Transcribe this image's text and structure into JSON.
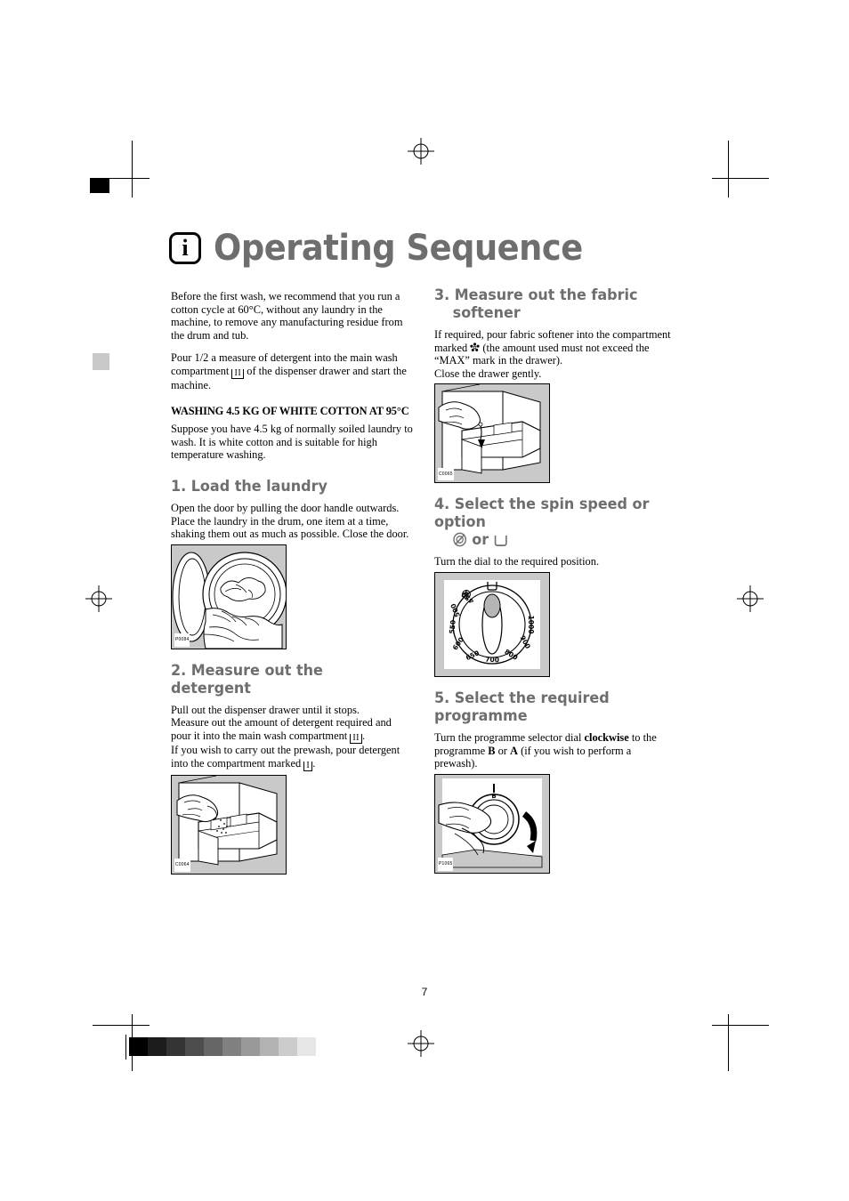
{
  "document": {
    "page_number": "7",
    "title": "Operating Sequence",
    "title_icon": "info-icon",
    "info_glyph": "i"
  },
  "left_column": {
    "intro": {
      "paragraph_1": "Before the first wash, we recommend that you run a cotton cycle at 60°C, without any laundry in the machine, to remove any manufacturing residue from the drum and tub.",
      "paragraph_2_part_1": "Pour 1/2 a measure of detergent into the main wash compartment ",
      "compartment_main": "II",
      "paragraph_2_part_2": " of the dispenser drawer and start the machine."
    },
    "subheading": "WASHING 4.5 KG OF WHITE COTTON AT 95°C",
    "subheading_body": "Suppose you have 4.5 kg of normally soiled laundry to wash. It is white cotton and is suitable for high temperature washing.",
    "step1": {
      "heading": "1. Load the laundry",
      "body": "Open the door by pulling the door handle outwards. Place the laundry in the drum, one item at a time, shaking them out as much as possible. Close the door.",
      "figure_code": "P0084",
      "figure_name": "loading-laundry-illustration"
    },
    "step2": {
      "heading": "2. Measure out the detergent",
      "body_1": "Pull out the dispenser drawer until it stops.",
      "body_2_part_1": "Measure out the amount of detergent required and pour it into the main wash compartment ",
      "compartment_main": "II",
      "body_2_part_2": ".",
      "body_3_part_1": "If you wish to carry out the prewash, pour detergent into the compartment marked ",
      "compartment_prewash": "I",
      "body_3_part_2": ".",
      "figure_code": "C0064",
      "figure_name": "detergent-drawer-illustration"
    }
  },
  "right_column": {
    "step3": {
      "heading_line_1": "3. Measure out the fabric",
      "heading_line_2": "softener",
      "body_part_1": "If required, pour fabric softener into the compartment marked ",
      "softener_symbol": "flower-icon",
      "body_part_2": " (the amount used must not exceed the “MAX” mark in the drawer).",
      "body_part_3": "Close the drawer gently.",
      "figure_code": "C0065",
      "figure_name": "fabric-softener-drawer-illustration"
    },
    "step4": {
      "heading_line_1": "4. Select the spin speed or option",
      "heading_line_2_icon_1": "no-spin-icon",
      "heading_line_2_text": "or",
      "heading_line_2_icon_2": "rinse-hold-icon",
      "body": "Turn the dial to the required position.",
      "figure_code": "",
      "figure_name": "spin-speed-dial-illustration",
      "dial_labels": [
        "1000",
        "900",
        "800",
        "700",
        "650",
        "600",
        "550",
        "500",
        "450"
      ],
      "dial_icon_top": "rinse-hold-icon",
      "dial_icon_left": "no-spin-icon"
    },
    "step5": {
      "heading": "5. Select the required programme",
      "body_part_1": "Turn the programme selector dial ",
      "bold_1": "clockwise",
      "body_part_2": " to the programme ",
      "bold_2": "B",
      "body_part_3": " or ",
      "bold_3": "A",
      "body_part_4": " (if you wish to perform a prewash).",
      "figure_code": "P1065",
      "figure_name": "programme-selector-illustration",
      "dial_marker": "B"
    }
  },
  "print_marks": {
    "grayscale_steps": [
      "#000000",
      "#1c1c1c",
      "#343434",
      "#4d4d4d",
      "#666666",
      "#808080",
      "#999999",
      "#b3b3b3",
      "#cccccc",
      "#e6e6e6"
    ]
  }
}
